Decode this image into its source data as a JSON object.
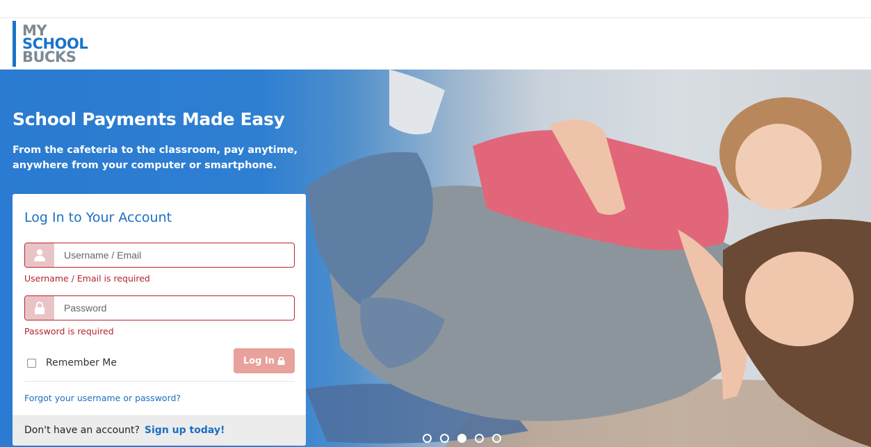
{
  "logo": {
    "line1": "MY",
    "line2": "SCHOOL",
    "line3": "BUCKS"
  },
  "hero": {
    "title": "School Payments Made Easy",
    "subtitle": "From the cafeteria to the classroom, pay anytime, anywhere from your computer or smartphone."
  },
  "login": {
    "title": "Log In to Your Account",
    "username_placeholder": "Username / Email",
    "username_value": "",
    "username_error": "Username / Email is required",
    "password_placeholder": "Password",
    "password_value": "",
    "password_error": "Password is required",
    "remember_label": "Remember Me",
    "remember_checked": false,
    "login_button": "Log In",
    "forgot_link": "Forgot your username or password?",
    "signup_prompt": "Don't have an account?",
    "signup_link": "Sign up today!"
  },
  "carousel": {
    "total": 5,
    "active_index": 2
  },
  "colors": {
    "brand_blue": "#1a73c8",
    "error_red": "#b5242a",
    "login_button": "#e8a19b"
  },
  "icons": {
    "username": "user-icon",
    "password": "lock-icon",
    "login": "lock-icon"
  }
}
